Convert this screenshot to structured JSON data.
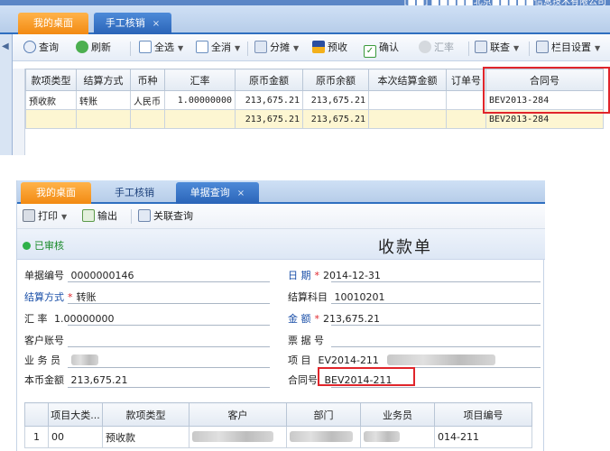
{
  "top": {
    "title_text": "[■■] ■■■■■北京■■■■■信息技术有限公司",
    "tabs": [
      {
        "label": "我的桌面"
      },
      {
        "label": "手工核销",
        "close": "×"
      }
    ],
    "toolbar": {
      "query": "查询",
      "refresh": "刷新",
      "select_all": "全选",
      "deselect_all": "全消",
      "split": "分摊",
      "prepay": "预收",
      "confirm": "确认",
      "exchange": "汇率",
      "link_query": "联查",
      "column_settings": "栏目设置"
    },
    "grid": {
      "headers": [
        "款项类型",
        "结算方式",
        "币种",
        "汇率",
        "原币金额",
        "原币余额",
        "本次结算金额",
        "订单号",
        "合同号"
      ],
      "row": [
        "预收款",
        "转账",
        "人民币",
        "1.00000000",
        "213,675.21",
        "213,675.21",
        "",
        "",
        "BEV2013-284"
      ],
      "sum_row": [
        "",
        "",
        "",
        "",
        "213,675.21",
        "213,675.21",
        "",
        "",
        "BEV2013-284"
      ]
    }
  },
  "bottom": {
    "tabs": [
      {
        "label": "我的桌面"
      },
      {
        "label": "手工核销"
      },
      {
        "label": "单据查询",
        "close": "×"
      }
    ],
    "toolbar": {
      "print": "打印",
      "export": "输出",
      "related_query": "关联查询"
    },
    "status": "已审核",
    "doc_title": "收款单",
    "form": {
      "doc_no_label": "单据编号",
      "doc_no": "0000000146",
      "date_label": "日 期",
      "date": "2014-12-31",
      "settle_method_label": "结算方式",
      "settle_method": "转账",
      "settle_subject_label": "结算科目",
      "settle_subject": "10010201",
      "rate_label": "汇 率",
      "rate": "1.00000000",
      "amount_label": "金 额",
      "amount": "213,675.21",
      "account_label": "客户账号",
      "ticket_label": "票 据 号",
      "salesman_label": "业 务 员",
      "project_label": "项 目",
      "project": "EV2014-211",
      "base_amount_label": "本币金额",
      "base_amount": "213,675.21",
      "contract_label": "合同号",
      "contract": "BEV2014-211",
      "required_mark": "*"
    },
    "grid": {
      "headers": [
        "",
        "项目大类...",
        "款项类型",
        "客户",
        "部门",
        "业务员",
        "项目编号"
      ],
      "row": [
        "1",
        "00",
        "预收款",
        "",
        "",
        "",
        "014-211"
      ]
    }
  },
  "colors": {
    "accent_blue": "#2f6fc0",
    "tab_orange": "#f28a12",
    "highlight_red": "#e0252b",
    "approved_green": "#1a8a2a"
  }
}
